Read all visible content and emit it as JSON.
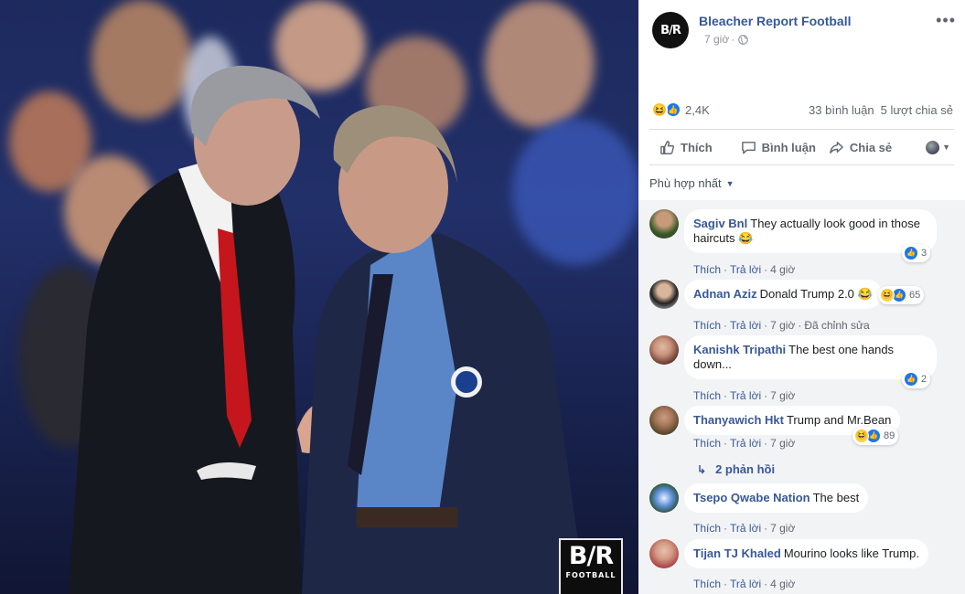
{
  "post": {
    "page_name": "Bleacher Report Football",
    "time": "7 giờ",
    "avatar_text": "B/R",
    "photo_logo_big": "B/R",
    "photo_logo_small": "FOOTBALL"
  },
  "reactions": {
    "count": "2,4K",
    "comments": "33 bình luận",
    "shares": "5 lượt chia sẻ"
  },
  "actions": {
    "like": "Thích",
    "comment": "Bình luận",
    "share": "Chia sẻ"
  },
  "sort": {
    "label": "Phù hợp nhất"
  },
  "comment_actions": {
    "like": "Thích",
    "reply": "Trả lời",
    "edited": "Đã chỉnh sửa"
  },
  "comments": [
    {
      "name": "Sagiv Bnl",
      "text": "They actually look good in those haircuts 😂",
      "time": "4 giờ",
      "reactions": "3"
    },
    {
      "name": "Adnan Aziz",
      "text": "Donald Trump 2.0 😂",
      "time": "7 giờ",
      "reactions": "65"
    },
    {
      "name": "Kanishk Tripathi",
      "text": "The best one hands down...",
      "time": "7 giờ",
      "reactions": "2"
    },
    {
      "name": "Thanyawich Hkt",
      "text": "Trump and Mr.Bean",
      "time": "7 giờ",
      "reactions": "89"
    },
    {
      "name": "Tsepo Qwabe Nation",
      "text": "The best",
      "time": "7 giờ",
      "reactions": ""
    },
    {
      "name": "Tijan TJ Khaled",
      "text": "Mourino looks like Trump.",
      "time": "4 giờ",
      "reactions": ""
    }
  ],
  "replies": {
    "label": "2 phản hồi"
  },
  "colors": {
    "link": "#385898",
    "like_blue": "#1877f2",
    "haha_yellow": "#f7d34a",
    "comment_bg": "#f2f3f5"
  }
}
